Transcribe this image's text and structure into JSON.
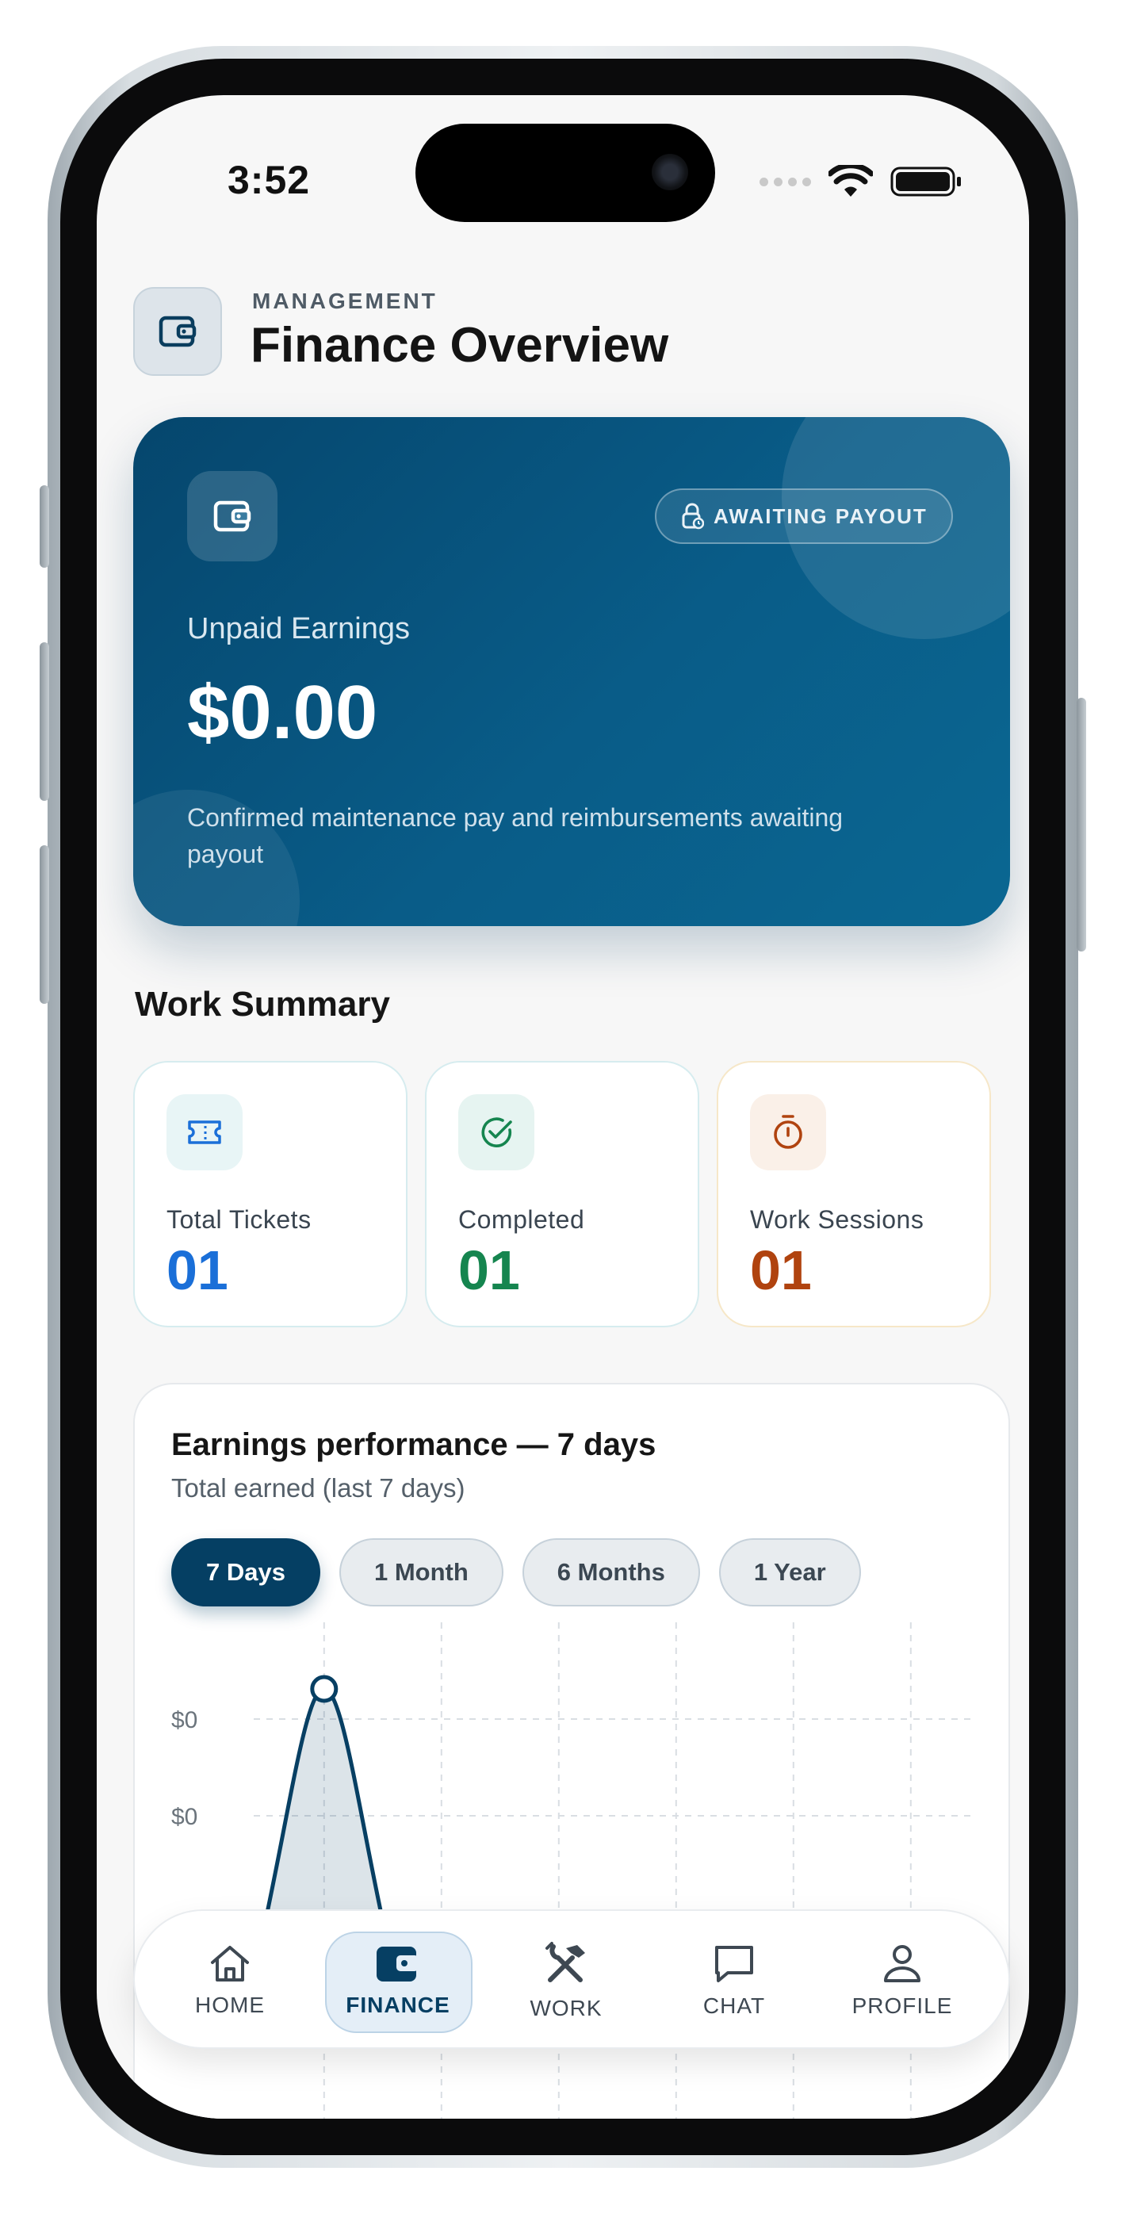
{
  "status_bar": {
    "time": "3:52"
  },
  "header": {
    "eyebrow": "MANAGEMENT",
    "title": "Finance Overview"
  },
  "hero": {
    "badge": "AWAITING PAYOUT",
    "label": "Unpaid Earnings",
    "amount": "$0.00",
    "description": "Confirmed maintenance pay and reimbursements awaiting payout"
  },
  "work_summary": {
    "title": "Work Summary",
    "stats": [
      {
        "label": "Total Tickets",
        "value": "01",
        "color": "#1a6fd8",
        "icon": "ticket-icon"
      },
      {
        "label": "Completed",
        "value": "01",
        "color": "#15854f",
        "icon": "check-circle-icon"
      },
      {
        "label": "Work Sessions",
        "value": "01",
        "color": "#b0430f",
        "icon": "stopwatch-icon"
      }
    ]
  },
  "earnings": {
    "title": "Earnings performance — 7 days",
    "subtitle": "Total earned (last 7 days)",
    "ranges": [
      "7 Days",
      "1 Month",
      "6 Months",
      "1 Year"
    ],
    "selected_range": "7 Days"
  },
  "chart_data": {
    "type": "area",
    "y_tick_labels": [
      "$0",
      "$0"
    ],
    "values": [
      0,
      0,
      0,
      0,
      0,
      0,
      0
    ],
    "peak_index": 1,
    "grid": true,
    "line_color": "#073f63"
  },
  "nav": {
    "items": [
      {
        "label": "HOME",
        "icon": "home-icon"
      },
      {
        "label": "FINANCE",
        "icon": "wallet-icon"
      },
      {
        "label": "WORK",
        "icon": "tools-icon"
      },
      {
        "label": "CHAT",
        "icon": "chat-icon"
      },
      {
        "label": "PROFILE",
        "icon": "profile-icon"
      }
    ],
    "active": "FINANCE"
  }
}
